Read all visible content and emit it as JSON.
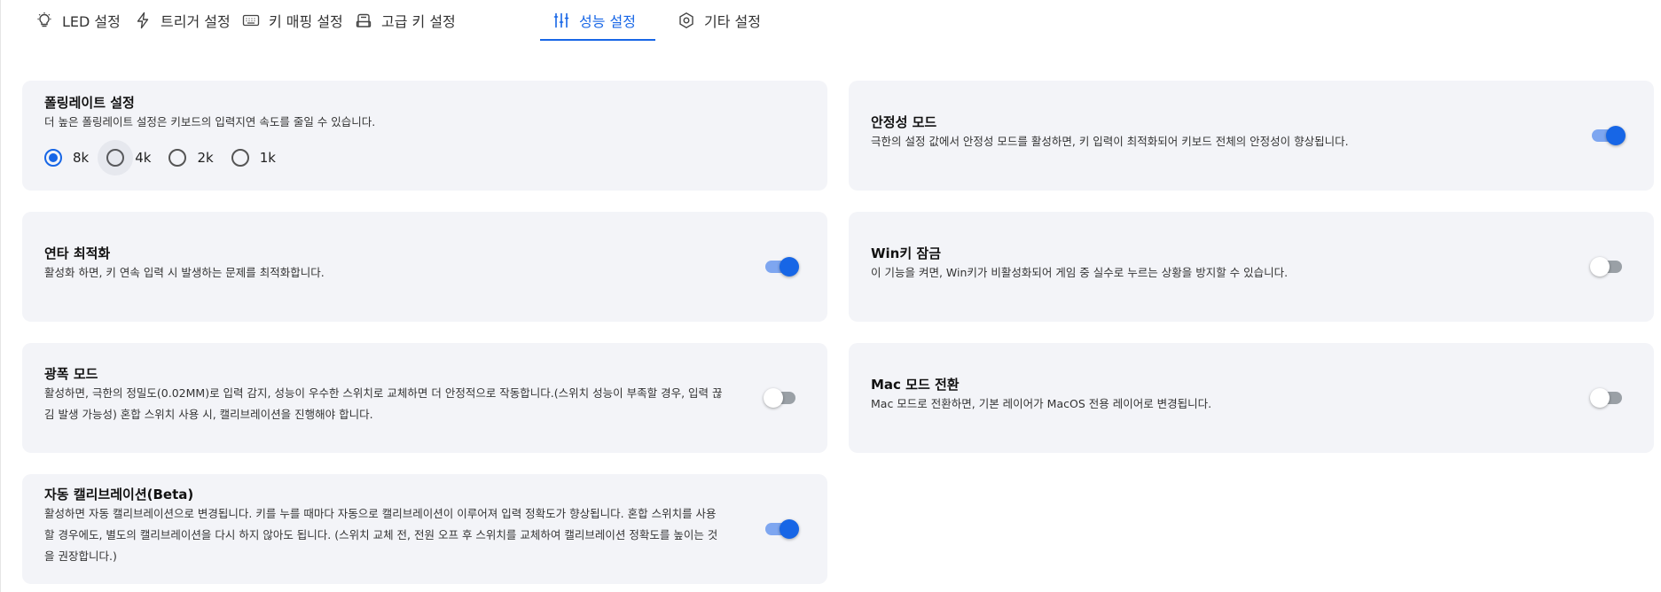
{
  "tabs": [
    {
      "label": "LED 설정",
      "icon": "bulb-icon",
      "active": false
    },
    {
      "label": "트리거 설정",
      "icon": "bolt-icon",
      "active": false
    },
    {
      "label": "키 매핑 설정",
      "icon": "keyboard-icon",
      "active": false
    },
    {
      "label": "고급 키 설정",
      "icon": "key-icon",
      "active": false
    },
    {
      "label": "성능 설정",
      "icon": "sliders-icon",
      "active": true
    },
    {
      "label": "기타 설정",
      "icon": "gear-icon",
      "active": false
    }
  ],
  "accent_color": "#1766e6",
  "polling": {
    "title": "폴링레이트 설정",
    "desc": "더 높은 폴링레이트 설정은 키보드의 입력지연 속도를 줄일 수 있습니다.",
    "options": [
      "8k",
      "4k",
      "2k",
      "1k"
    ],
    "selected": "8k"
  },
  "stability": {
    "title": "안정성 모드",
    "desc": "극한의 설정 값에서 안정성 모드를 활성하면, 키 입력이 최적화되어 키보드 전체의 안정성이 향상됩니다.",
    "enabled": true
  },
  "rapid": {
    "title": "연타 최적화",
    "desc": "활성화 하면, 키 연속 입력 시 발생하는 문제를 최적화합니다.",
    "enabled": true
  },
  "winlock": {
    "title": "Win키 잠금",
    "desc": "이 기능을 켜면, Win키가 비활성화되어 게임 중 실수로 누르는 상황을 방지할 수 있습니다.",
    "enabled": false
  },
  "extreme": {
    "title": "광폭 모드",
    "desc_line1": "활성하면, 극한의 정밀도(0.02MM)로 입력 감지, 성능이 우수한 스위치로 교체하면 더 안정적으로 작동합니다.(스위치 성능이 부족할 경우, 입력 끊",
    "desc_line2": "김 발생 가능성) 혼합 스위치 사용 시, 캘리브레이션을 진행해야 합니다.",
    "enabled": false
  },
  "macmode": {
    "title": "Mac 모드 전환",
    "desc": "Mac 모드로 전환하면, 기본 레이어가 MacOS 전용 레이어로 변경됩니다.",
    "enabled": false
  },
  "autocal": {
    "title": "자동 캘리브레이션(Beta)",
    "desc_line1": "활성하면 자동 캘리브레이션으로 변경됩니다. 키를 누를 때마다 자동으로 캘리브레이션이 이루어져 입력 정확도가 향상됩니다. 혼합 스위치를 사용",
    "desc_line2": "할 경우에도, 별도의 캘리브레이션을 다시 하지 않아도 됩니다. (스위치 교체 전, 전원 오프 후 스위치를 교체하여 캘리브레이션 정확도를 높이는 것",
    "desc_line3": "을 권장합니다.)",
    "enabled": true
  }
}
